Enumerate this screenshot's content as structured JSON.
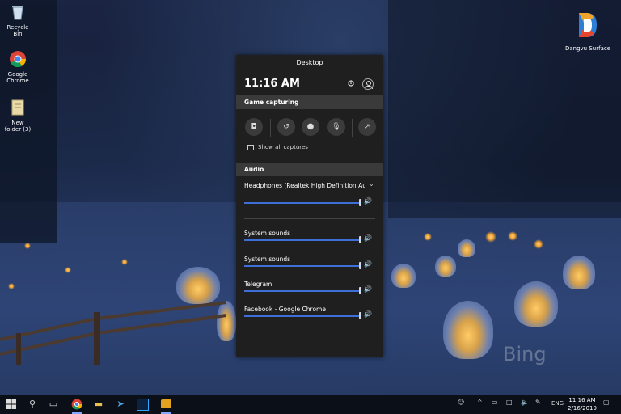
{
  "desktop": {
    "icons": [
      {
        "label": "Recycle Bin"
      },
      {
        "label": "Google Chrome"
      },
      {
        "label": "New folder (3)"
      }
    ],
    "logo_text": "Dangvu Surface",
    "bing_watermark": "Bing"
  },
  "game_bar": {
    "title": "Desktop",
    "time": "11:16 AM",
    "icons": {
      "settings": "gear-icon",
      "account": "user-icon"
    },
    "capture_section": {
      "heading": "Game capturing",
      "buttons": [
        "screenshot-icon",
        "record-last-icon",
        "record-icon",
        "mic-off-icon",
        "broadcast-icon"
      ],
      "show_all_label": "Show all captures"
    },
    "audio_section": {
      "heading": "Audio",
      "device": "Headphones (Realtek High Definition Audio)",
      "master_volume": 1.0,
      "apps": [
        {
          "name": "System sounds",
          "volume": 1.0
        },
        {
          "name": "System sounds",
          "volume": 1.0
        },
        {
          "name": "Telegram",
          "volume": 1.0
        },
        {
          "name": "Facebook - Google Chrome",
          "volume": 1.0
        }
      ]
    }
  },
  "taskbar": {
    "pinned": [
      "windows-icon",
      "search-icon",
      "task-view-icon",
      "chrome-icon",
      "file-explorer-icon",
      "telegram-icon",
      "photoshop-icon",
      "media-app-icon"
    ],
    "tray": {
      "language": "ENG"
    },
    "clock": {
      "time": "11:16 AM",
      "date": "2/16/2019"
    }
  },
  "colors": {
    "panel_bg": "#1f1f1f",
    "section_bg": "#3a3a3a",
    "accent": "#3e6fd8",
    "taskbar_bg": "#0b0f18"
  }
}
